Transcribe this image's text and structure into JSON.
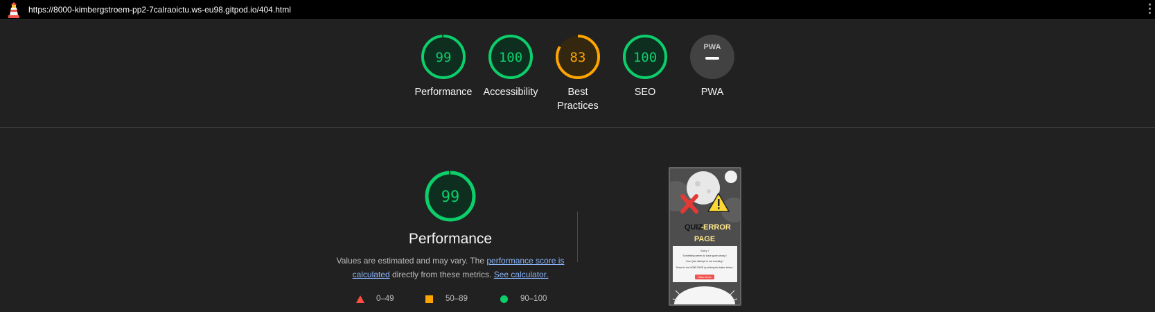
{
  "topbar": {
    "url": "https://8000-kimbergstroem-pp2-7calraoictu.ws-eu98.gitpod.io/404.html"
  },
  "gauges": [
    {
      "label": "Performance",
      "score": "99",
      "value": 0.99,
      "color": "#0cce6b",
      "bg": "#0e2f1f"
    },
    {
      "label": "Accessibility",
      "score": "100",
      "value": 1.0,
      "color": "#0cce6b",
      "bg": "#0e2f1f"
    },
    {
      "label": "Best Practices",
      "label_line1": "Best",
      "label_line2": "Practices",
      "score": "83",
      "value": 0.83,
      "color": "#ffa400",
      "bg": "#33270f"
    },
    {
      "label": "SEO",
      "score": "100",
      "value": 1.0,
      "color": "#0cce6b",
      "bg": "#0e2f1f"
    },
    {
      "label": "PWA",
      "score": "—",
      "badge": "PWA",
      "color": "#c7c7c7",
      "bg": "#424242"
    }
  ],
  "performance": {
    "score": "99",
    "value": 0.99,
    "title": "Performance",
    "desc_prefix": "Values are estimated and may vary. The ",
    "link_score": "performance score is calculated",
    "desc_mid": " directly from these metrics. ",
    "link_calc": "See calculator."
  },
  "legend": [
    {
      "range": "0–49",
      "shape": "triangle",
      "color": "#ff4e42"
    },
    {
      "range": "50–89",
      "shape": "square",
      "color": "#ffa400"
    },
    {
      "range": "90–100",
      "shape": "circle",
      "color": "#0cce6b"
    }
  ],
  "thumbnail": {
    "heading_a": "QUIZ",
    "heading_sep": " - ",
    "heading_b": "ERROR",
    "heading_c": "PAGE",
    "line1": "Sorry !",
    "line2": "Something seems to have gone wrong !",
    "line3": "Your Quiz attempt is not counting !",
    "line4": "Return to the HOME PAGE by clicking the button below !",
    "button": "Return Home"
  }
}
